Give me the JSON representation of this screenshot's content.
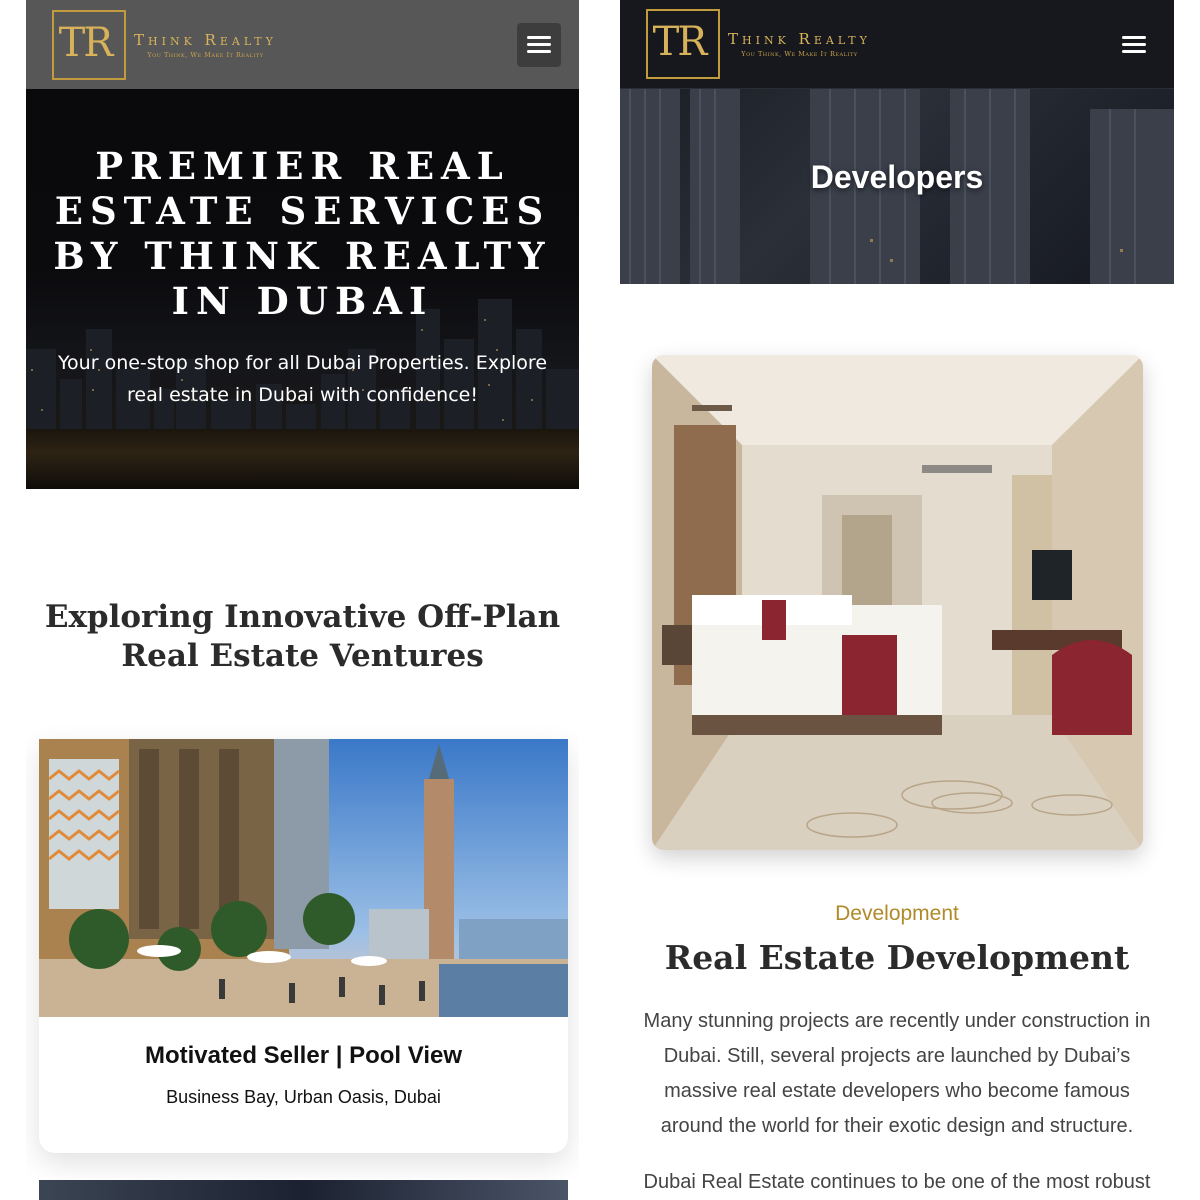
{
  "brand": {
    "logo_mark": "TR",
    "name": "Think Realty",
    "tagline": "You Think, We Make It Reality"
  },
  "left": {
    "hero": {
      "title": "PREMIER REAL ESTATE SERVICES BY THINK REALTY IN DUBAI",
      "subtitle": "Your one-stop shop for all Dubai Properties. Explore real estate in Dubai with confidence!"
    },
    "section_heading": "Exploring Innovative Off-Plan Real Estate Ventures",
    "listing": {
      "title": "Motivated Seller | Pool View",
      "location": "Business Bay, Urban Oasis, Dubai"
    }
  },
  "right": {
    "hero_title": "Developers",
    "eyebrow": "Development",
    "heading": "Real Estate Development",
    "body": "Many stunning projects are recently under construction in Dubai. Still, several projects are launched by Dubai’s massive real estate developers who become famous around the world for their exotic design and structure.",
    "body2": "Dubai Real Estate continues to be one of the most robust"
  },
  "colors": {
    "gold": "#c29b3f",
    "accent_text": "#b08a2a",
    "header_left": "#575757",
    "header_right": "#16181d"
  },
  "icons": {
    "menu": "hamburger-menu-icon"
  }
}
